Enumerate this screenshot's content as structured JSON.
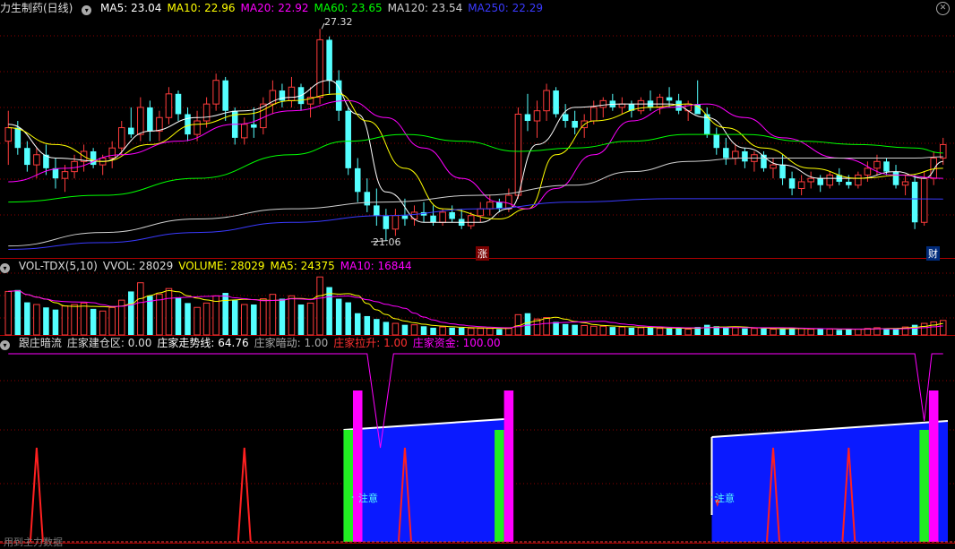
{
  "colors": {
    "up": "#ff3c3c",
    "down": "#54ffff",
    "ma5": "#ffffff",
    "ma10": "#ffff00",
    "ma20": "#ff00ff",
    "ma60": "#00ff00",
    "ma120": "#d0d0d0",
    "ma250": "#3a3aff",
    "axis": "#8b0000"
  },
  "header": {
    "title": "力生制药(日线)",
    "ma": [
      {
        "label": "MA5: 23.04",
        "color": "#ffffff"
      },
      {
        "label": "MA10: 22.96",
        "color": "#ffff00"
      },
      {
        "label": "MA20: 22.92",
        "color": "#ff00ff"
      },
      {
        "label": "MA60: 23.65",
        "color": "#00ff00"
      },
      {
        "label": "MA120: 23.54",
        "color": "#d0d0d0"
      },
      {
        "label": "MA250: 22.29",
        "color": "#3a3aff"
      }
    ]
  },
  "vol_header": {
    "items": [
      {
        "label": "VOL-TDX(5,10)",
        "color": "#dddddd"
      },
      {
        "label": "VVOL: 28029",
        "color": "#dddddd"
      },
      {
        "label": "VOLUME: 28029",
        "color": "#ffff00"
      },
      {
        "label": "MA5: 24375",
        "color": "#ffff00"
      },
      {
        "label": "MA10: 16844",
        "color": "#ff00ff"
      }
    ]
  },
  "ind_header": {
    "items": [
      {
        "label": "跟庄暗流",
        "color": "#dddddd"
      },
      {
        "label": "庄家建仓区: 0.00",
        "color": "#dddddd"
      },
      {
        "label": "庄家走势线: 64.76",
        "color": "#ffffff"
      },
      {
        "label": "庄家暗动: 1.00",
        "color": "#aaaaaa"
      },
      {
        "label": "庄家拉升: 1.00",
        "color": "#ff3030"
      },
      {
        "label": "庄家资金: 100.00",
        "color": "#ff00ff"
      }
    ]
  },
  "annotations": {
    "high": "27.32",
    "low": "21.06",
    "zhang": "涨",
    "cai": "财",
    "zhuyi": "注意",
    "footer": "用到主力数据"
  },
  "chart_data": {
    "type": "candlestick",
    "n": 100,
    "price_range": [
      20.6,
      27.7
    ],
    "high_label": 27.32,
    "low_label": 21.06,
    "ohlc": [
      [
        24.0,
        24.9,
        23.3,
        24.4
      ],
      [
        24.4,
        24.6,
        23.6,
        23.8
      ],
      [
        23.8,
        24.0,
        23.1,
        23.3
      ],
      [
        23.3,
        23.8,
        22.9,
        23.6
      ],
      [
        23.6,
        23.9,
        23.0,
        23.2
      ],
      [
        23.2,
        23.5,
        22.6,
        22.9
      ],
      [
        22.9,
        23.3,
        22.5,
        23.1
      ],
      [
        23.1,
        23.6,
        22.9,
        23.4
      ],
      [
        23.4,
        23.9,
        23.1,
        23.7
      ],
      [
        23.7,
        23.8,
        23.2,
        23.3
      ],
      [
        23.3,
        23.6,
        23.0,
        23.5
      ],
      [
        23.5,
        24.0,
        23.2,
        23.8
      ],
      [
        23.8,
        24.6,
        23.6,
        24.4
      ],
      [
        24.4,
        25.0,
        24.1,
        24.2
      ],
      [
        24.2,
        25.3,
        24.0,
        25.0
      ],
      [
        25.0,
        25.2,
        24.0,
        24.3
      ],
      [
        24.3,
        24.9,
        24.0,
        24.7
      ],
      [
        24.7,
        25.6,
        24.5,
        25.4
      ],
      [
        25.4,
        25.5,
        24.6,
        24.8
      ],
      [
        24.8,
        25.0,
        24.0,
        24.2
      ],
      [
        24.2,
        24.9,
        24.0,
        24.6
      ],
      [
        24.6,
        25.3,
        24.4,
        25.1
      ],
      [
        25.1,
        26.0,
        24.9,
        25.8
      ],
      [
        25.8,
        25.9,
        24.6,
        24.9
      ],
      [
        24.9,
        25.0,
        23.9,
        24.1
      ],
      [
        24.1,
        24.7,
        23.9,
        24.5
      ],
      [
        24.5,
        25.0,
        24.1,
        24.4
      ],
      [
        24.4,
        25.3,
        24.2,
        25.1
      ],
      [
        25.1,
        25.8,
        24.8,
        25.5
      ],
      [
        25.5,
        25.7,
        25.0,
        25.2
      ],
      [
        25.2,
        25.9,
        25.0,
        25.6
      ],
      [
        25.6,
        25.7,
        24.9,
        25.1
      ],
      [
        25.1,
        25.6,
        24.7,
        25.3
      ],
      [
        25.3,
        27.32,
        25.1,
        27.0
      ],
      [
        27.0,
        27.1,
        25.4,
        25.8
      ],
      [
        25.8,
        26.1,
        24.6,
        24.9
      ],
      [
        24.9,
        25.0,
        23.0,
        23.2
      ],
      [
        23.2,
        23.5,
        22.2,
        22.5
      ],
      [
        22.5,
        22.9,
        21.9,
        22.1
      ],
      [
        22.1,
        22.6,
        21.5,
        21.8
      ],
      [
        21.8,
        22.0,
        21.06,
        21.4
      ],
      [
        21.4,
        22.0,
        21.2,
        21.8
      ],
      [
        21.8,
        22.3,
        21.5,
        21.7
      ],
      [
        21.7,
        22.1,
        21.5,
        21.9
      ],
      [
        21.9,
        22.2,
        21.6,
        21.8
      ],
      [
        21.8,
        22.1,
        21.5,
        21.6
      ],
      [
        21.6,
        22.0,
        21.5,
        21.9
      ],
      [
        21.9,
        22.1,
        21.6,
        21.7
      ],
      [
        21.7,
        22.0,
        21.4,
        21.5
      ],
      [
        21.5,
        21.9,
        21.4,
        21.8
      ],
      [
        21.8,
        22.2,
        21.6,
        22.0
      ],
      [
        22.0,
        22.4,
        21.8,
        22.2
      ],
      [
        22.2,
        22.3,
        21.9,
        22.0
      ],
      [
        22.0,
        22.6,
        21.9,
        22.4
      ],
      [
        22.4,
        25.0,
        22.3,
        24.8
      ],
      [
        24.8,
        25.4,
        24.3,
        24.6
      ],
      [
        24.6,
        25.2,
        24.1,
        24.9
      ],
      [
        24.9,
        25.7,
        24.6,
        25.5
      ],
      [
        25.5,
        25.6,
        24.7,
        24.8
      ],
      [
        24.8,
        25.1,
        24.4,
        24.6
      ],
      [
        24.6,
        24.9,
        24.2,
        24.4
      ],
      [
        24.4,
        24.8,
        24.1,
        24.6
      ],
      [
        24.6,
        25.2,
        24.5,
        25.0
      ],
      [
        25.0,
        25.3,
        24.7,
        25.2
      ],
      [
        25.2,
        25.4,
        24.9,
        25.0
      ],
      [
        25.0,
        25.3,
        24.8,
        25.1
      ],
      [
        25.1,
        25.2,
        24.7,
        24.9
      ],
      [
        24.9,
        25.3,
        24.8,
        25.2
      ],
      [
        25.2,
        25.5,
        24.9,
        25.0
      ],
      [
        25.0,
        25.4,
        24.8,
        25.3
      ],
      [
        25.3,
        25.6,
        25.0,
        25.2
      ],
      [
        25.2,
        25.4,
        24.8,
        24.9
      ],
      [
        24.9,
        25.2,
        24.6,
        25.1
      ],
      [
        25.1,
        25.8,
        24.9,
        24.8
      ],
      [
        24.8,
        25.0,
        24.1,
        24.2
      ],
      [
        24.2,
        24.4,
        23.6,
        23.8
      ],
      [
        23.8,
        24.1,
        23.3,
        23.5
      ],
      [
        23.5,
        23.9,
        23.3,
        23.7
      ],
      [
        23.7,
        23.8,
        23.2,
        23.4
      ],
      [
        23.4,
        23.7,
        23.1,
        23.6
      ],
      [
        23.6,
        23.7,
        23.1,
        23.2
      ],
      [
        23.2,
        23.5,
        22.9,
        23.3
      ],
      [
        23.3,
        23.6,
        22.7,
        22.9
      ],
      [
        22.9,
        23.1,
        22.4,
        22.6
      ],
      [
        22.6,
        23.0,
        22.4,
        22.8
      ],
      [
        22.8,
        23.1,
        22.6,
        22.9
      ],
      [
        22.9,
        23.0,
        22.5,
        22.7
      ],
      [
        22.7,
        23.1,
        22.6,
        23.0
      ],
      [
        23.0,
        23.2,
        22.7,
        22.8
      ],
      [
        22.8,
        23.0,
        22.6,
        22.7
      ],
      [
        22.7,
        23.1,
        22.6,
        23.0
      ],
      [
        23.0,
        23.4,
        22.8,
        23.2
      ],
      [
        23.2,
        23.6,
        23.0,
        23.4
      ],
      [
        23.4,
        23.5,
        23.0,
        23.1
      ],
      [
        23.1,
        23.3,
        22.6,
        22.7
      ],
      [
        22.7,
        23.0,
        22.4,
        22.8
      ],
      [
        22.8,
        23.0,
        21.4,
        21.6
      ],
      [
        21.6,
        23.1,
        21.5,
        22.9
      ],
      [
        22.9,
        23.7,
        22.7,
        23.5
      ],
      [
        23.5,
        24.1,
        23.3,
        23.9
      ]
    ],
    "volume": [
      60,
      62,
      45,
      42,
      38,
      35,
      40,
      42,
      44,
      36,
      33,
      38,
      48,
      60,
      72,
      54,
      56,
      64,
      52,
      44,
      38,
      44,
      54,
      58,
      48,
      42,
      42,
      50,
      56,
      50,
      54,
      42,
      44,
      80,
      66,
      50,
      45,
      30,
      26,
      22,
      18,
      16,
      14,
      14,
      12,
      10,
      11,
      10,
      10,
      9,
      9,
      9,
      8,
      10,
      28,
      30,
      22,
      24,
      18,
      15,
      14,
      13,
      12,
      12,
      11,
      11,
      10,
      10,
      10,
      9,
      9,
      9,
      8,
      11,
      14,
      12,
      10,
      10,
      9,
      9,
      9,
      8,
      8,
      10,
      9,
      8,
      8,
      8,
      7,
      8,
      8,
      9,
      10,
      9,
      9,
      11,
      14,
      16,
      18,
      20
    ],
    "ma_series": {
      "ma5": [
        [
          0,
          24.5
        ],
        [
          5,
          23.5
        ],
        [
          10,
          23.4
        ],
        [
          15,
          24.3
        ],
        [
          20,
          24.7
        ],
        [
          25,
          24.9
        ],
        [
          30,
          25.3
        ],
        [
          34,
          25.8
        ],
        [
          37,
          24.8
        ],
        [
          40,
          22.5
        ],
        [
          44,
          21.6
        ],
        [
          50,
          21.6
        ],
        [
          53,
          22.0
        ],
        [
          56,
          23.9
        ],
        [
          60,
          25.0
        ],
        [
          65,
          25.1
        ],
        [
          70,
          25.1
        ],
        [
          74,
          24.7
        ],
        [
          78,
          23.8
        ],
        [
          82,
          23.3
        ],
        [
          86,
          22.9
        ],
        [
          90,
          22.9
        ],
        [
          94,
          23.1
        ],
        [
          97,
          22.9
        ],
        [
          99,
          23.4
        ]
      ],
      "ma10": [
        [
          0,
          24.4
        ],
        [
          5,
          23.9
        ],
        [
          10,
          23.4
        ],
        [
          15,
          23.9
        ],
        [
          20,
          24.5
        ],
        [
          25,
          24.8
        ],
        [
          30,
          25.2
        ],
        [
          35,
          25.4
        ],
        [
          38,
          24.6
        ],
        [
          42,
          23.2
        ],
        [
          46,
          22.0
        ],
        [
          52,
          21.7
        ],
        [
          55,
          22.0
        ],
        [
          58,
          23.6
        ],
        [
          62,
          24.6
        ],
        [
          68,
          25.0
        ],
        [
          72,
          25.1
        ],
        [
          76,
          24.4
        ],
        [
          80,
          23.8
        ],
        [
          85,
          23.2
        ],
        [
          90,
          22.9
        ],
        [
          95,
          23.0
        ],
        [
          99,
          23.2
        ]
      ],
      "ma20": [
        [
          0,
          22.8
        ],
        [
          6,
          23.2
        ],
        [
          12,
          23.6
        ],
        [
          18,
          24.0
        ],
        [
          24,
          24.5
        ],
        [
          30,
          24.9
        ],
        [
          36,
          25.2
        ],
        [
          40,
          24.7
        ],
        [
          44,
          23.8
        ],
        [
          48,
          22.9
        ],
        [
          52,
          22.2
        ],
        [
          55,
          22.0
        ],
        [
          58,
          22.6
        ],
        [
          62,
          23.6
        ],
        [
          66,
          24.6
        ],
        [
          70,
          25.0
        ],
        [
          74,
          25.1
        ],
        [
          78,
          24.7
        ],
        [
          82,
          24.1
        ],
        [
          88,
          23.5
        ],
        [
          94,
          23.0
        ],
        [
          99,
          22.9
        ]
      ],
      "ma60": [
        [
          0,
          22.2
        ],
        [
          10,
          22.4
        ],
        [
          20,
          22.9
        ],
        [
          30,
          23.6
        ],
        [
          36,
          24.0
        ],
        [
          42,
          24.2
        ],
        [
          48,
          24.0
        ],
        [
          54,
          23.7
        ],
        [
          60,
          23.8
        ],
        [
          66,
          24.0
        ],
        [
          72,
          24.2
        ],
        [
          78,
          24.2
        ],
        [
          84,
          24.0
        ],
        [
          90,
          23.9
        ],
        [
          96,
          23.8
        ],
        [
          99,
          23.65
        ]
      ],
      "ma120": [
        [
          0,
          20.9
        ],
        [
          10,
          21.3
        ],
        [
          20,
          21.7
        ],
        [
          30,
          22.0
        ],
        [
          40,
          22.2
        ],
        [
          50,
          22.4
        ],
        [
          60,
          22.7
        ],
        [
          66,
          23.1
        ],
        [
          72,
          23.4
        ],
        [
          78,
          23.5
        ],
        [
          84,
          23.5
        ],
        [
          90,
          23.5
        ],
        [
          96,
          23.5
        ],
        [
          99,
          23.54
        ]
      ],
      "ma250": [
        [
          0,
          20.8
        ],
        [
          10,
          21.0
        ],
        [
          20,
          21.3
        ],
        [
          30,
          21.6
        ],
        [
          40,
          21.8
        ],
        [
          50,
          22.0
        ],
        [
          60,
          22.2
        ],
        [
          70,
          22.3
        ],
        [
          80,
          22.3
        ],
        [
          90,
          22.3
        ],
        [
          99,
          22.29
        ]
      ]
    },
    "indicator": {
      "zones": [
        [
          36,
          52
        ],
        [
          75,
          99
        ]
      ],
      "red_spikes": [
        3,
        25,
        42,
        81,
        89
      ],
      "magenta_bars": [
        37,
        53,
        98
      ],
      "green_bars": [
        36,
        52,
        97
      ]
    }
  }
}
